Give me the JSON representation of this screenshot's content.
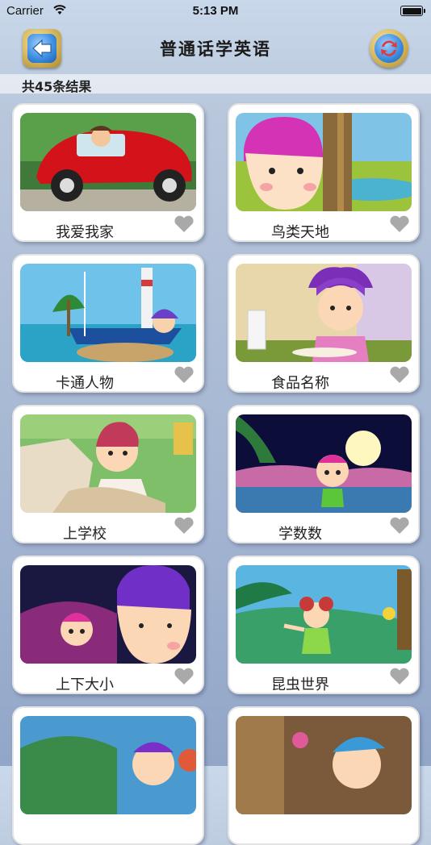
{
  "status_bar": {
    "carrier": "Carrier",
    "time": "5:13 PM",
    "battery_level": 1.0
  },
  "nav": {
    "title": "普通话学英语",
    "back_icon": "back-arrow-icon",
    "refresh_icon": "refresh-icon"
  },
  "result_count": "共45条结果",
  "items": [
    {
      "title": "我爱我家",
      "favorite": false
    },
    {
      "title": "鸟类天地",
      "favorite": false
    },
    {
      "title": "卡通人物",
      "favorite": false
    },
    {
      "title": "食品名称",
      "favorite": false
    },
    {
      "title": "上学校",
      "favorite": false
    },
    {
      "title": "学数数",
      "favorite": false
    },
    {
      "title": "上下大小",
      "favorite": false
    },
    {
      "title": "昆虫世界",
      "favorite": false
    },
    {
      "title": "",
      "favorite": false
    },
    {
      "title": "",
      "favorite": false
    }
  ],
  "colors": {
    "heart": "#a9a9a9",
    "card_bg": "#ffffff",
    "nav_button_gold": "#d5b55a",
    "nav_button_blue": "#3f8fe2"
  }
}
